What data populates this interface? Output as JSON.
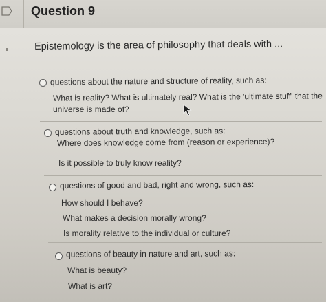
{
  "question": {
    "title": "Question 9",
    "prompt": "Epistemology is the area of philosophy that deals with ..."
  },
  "options": [
    {
      "label": "questions about the nature and structure of reality, such as:",
      "examples": [
        "What is reality? What is ultimately real? What is the 'ultimate stuff' that the",
        "universe is made of?"
      ]
    },
    {
      "label": "questions about truth and knowledge, such as:",
      "examples": [
        "Where does knowledge come from (reason or experience)?",
        "Is it possible to truly know reality?"
      ]
    },
    {
      "label": "questions of good and bad, right and wrong, such as:",
      "examples": [
        "How should I behave?",
        "What makes a decision morally wrong?",
        "Is morality relative to the individual or culture?"
      ]
    },
    {
      "label": "questions of beauty in nature and art, such as:",
      "examples": [
        "What is beauty?",
        "What is art?"
      ]
    }
  ],
  "icons": {
    "flag": "flag-outline-icon",
    "cursor": "mouse-pointer-icon",
    "radio": "radio-unselected-icon"
  }
}
